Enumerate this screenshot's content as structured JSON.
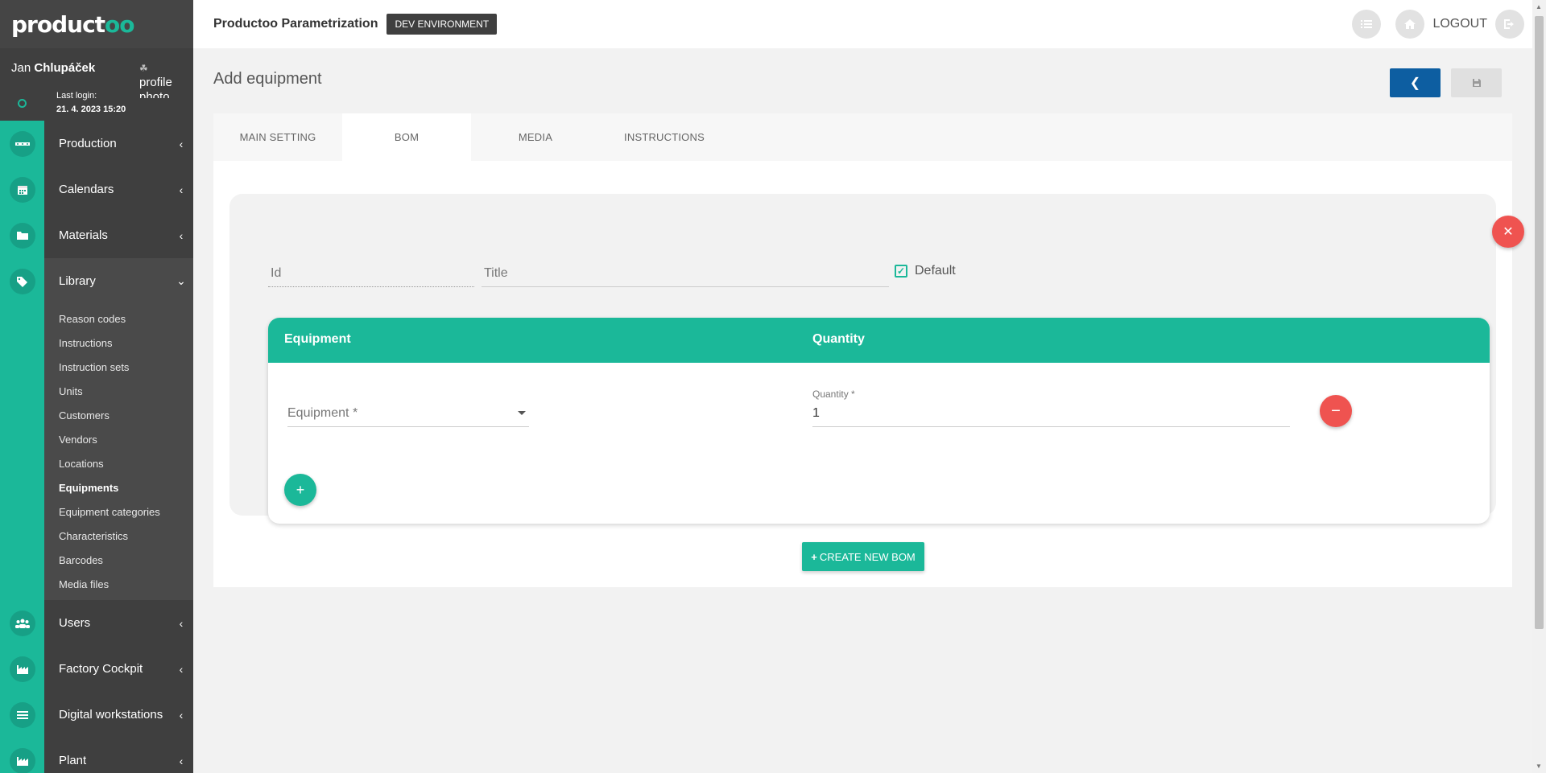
{
  "brand": {
    "logo_text": "product",
    "logo_suffix": "oo"
  },
  "user": {
    "first_name": "Jan",
    "last_name": "Chlupáček",
    "last_login_label": "Last login:",
    "last_login_date": "21. 4. 2023 15:20",
    "profile_photo_alt": "profile photo"
  },
  "sidebar": {
    "items": [
      {
        "label": "Production",
        "icon": "conveyor-icon"
      },
      {
        "label": "Calendars",
        "icon": "calendar-icon"
      },
      {
        "label": "Materials",
        "icon": "folder-icon"
      },
      {
        "label": "Library",
        "icon": "tags-icon"
      },
      {
        "label": "Users",
        "icon": "users-icon"
      },
      {
        "label": "Factory Cockpit",
        "icon": "factory-icon"
      },
      {
        "label": "Digital workstations",
        "icon": "list-icon"
      },
      {
        "label": "Plant",
        "icon": "plant-icon"
      }
    ],
    "library_submenu": [
      "Reason codes",
      "Instructions",
      "Instruction sets",
      "Units",
      "Customers",
      "Vendors",
      "Locations",
      "Equipments",
      "Equipment categories",
      "Characteristics",
      "Barcodes",
      "Media files"
    ],
    "active_submenu": "Equipments"
  },
  "header": {
    "app_title": "Productoo Parametrization",
    "env_badge": "DEV ENVIRONMENT",
    "logout_label": "LOGOUT"
  },
  "page": {
    "title": "Add equipment",
    "tabs": [
      "MAIN SETTING",
      "BOM",
      "MEDIA",
      "INSTRUCTIONS"
    ],
    "active_tab": "BOM"
  },
  "bom": {
    "id_placeholder": "Id",
    "title_placeholder": "Title",
    "default_label": "Default",
    "default_checked": true,
    "table": {
      "col_equipment": "Equipment",
      "col_quantity": "Quantity",
      "equipment_placeholder": "Equipment *",
      "quantity_label": "Quantity *",
      "quantity_value": "1"
    },
    "create_button": "CREATE NEW BOM"
  },
  "colors": {
    "accent": "#1bb899",
    "sidebar_bg": "#3f3f3f",
    "primary_button": "#0d5ea1",
    "danger": "#ef5350"
  }
}
